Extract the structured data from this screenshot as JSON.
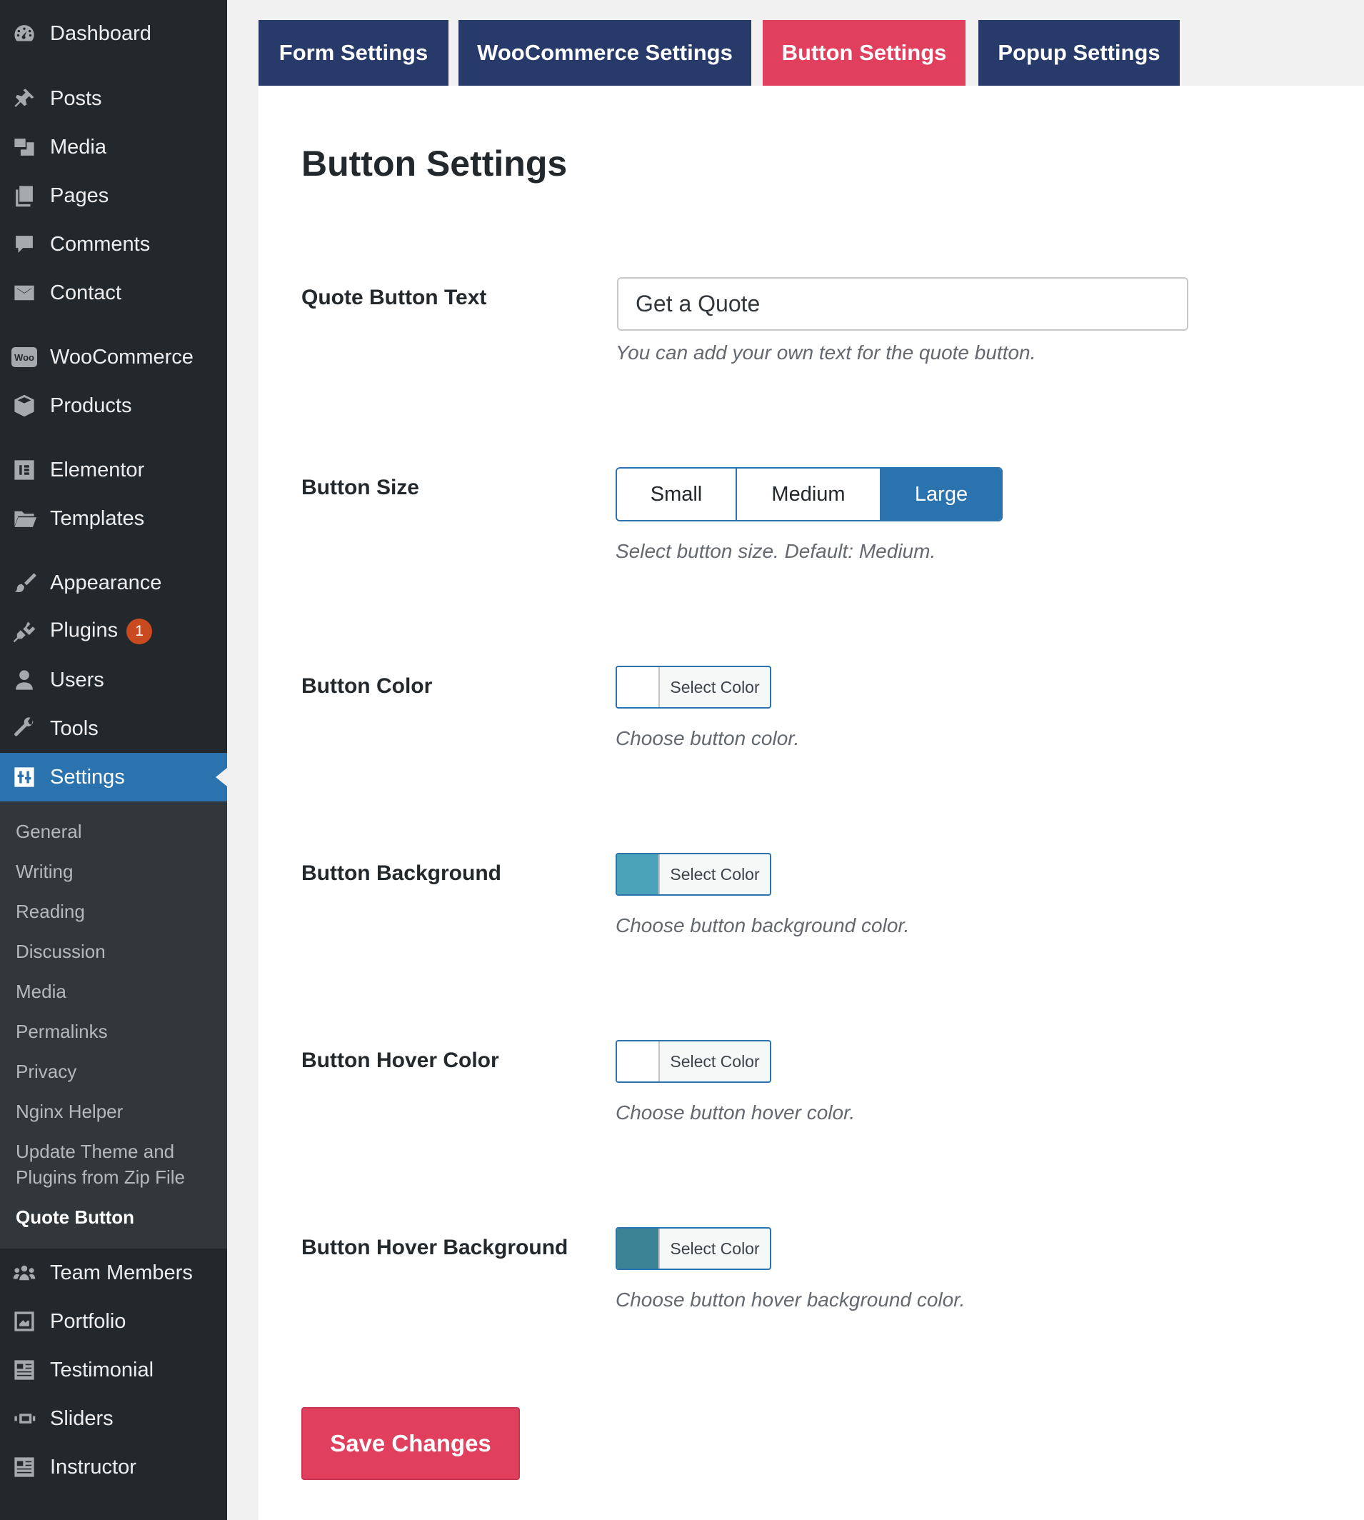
{
  "sidebar": {
    "items": [
      {
        "label": "Dashboard",
        "icon": "dashboard-icon"
      },
      {
        "label": "Posts",
        "icon": "pin-icon"
      },
      {
        "label": "Media",
        "icon": "media-icon"
      },
      {
        "label": "Pages",
        "icon": "pages-icon"
      },
      {
        "label": "Comments",
        "icon": "comment-icon"
      },
      {
        "label": "Contact",
        "icon": "envelope-icon"
      },
      {
        "label": "WooCommerce",
        "icon": "woo-icon",
        "icon_text": "Woo"
      },
      {
        "label": "Products",
        "icon": "box-icon"
      },
      {
        "label": "Elementor",
        "icon": "elementor-icon"
      },
      {
        "label": "Templates",
        "icon": "folder-icon"
      },
      {
        "label": "Appearance",
        "icon": "brush-icon"
      },
      {
        "label": "Plugins",
        "icon": "plugin-icon",
        "badge": "1"
      },
      {
        "label": "Users",
        "icon": "user-icon"
      },
      {
        "label": "Tools",
        "icon": "wrench-icon"
      },
      {
        "label": "Settings",
        "icon": "settings-icon"
      },
      {
        "label": "Team Members",
        "icon": "team-icon"
      },
      {
        "label": "Portfolio",
        "icon": "portfolio-icon"
      },
      {
        "label": "Testimonial",
        "icon": "testimonial-icon"
      },
      {
        "label": "Sliders",
        "icon": "slider-icon"
      },
      {
        "label": "Instructor",
        "icon": "instructor-icon"
      }
    ],
    "settings_submenu": [
      "General",
      "Writing",
      "Reading",
      "Discussion",
      "Media",
      "Permalinks",
      "Privacy",
      "Nginx Helper",
      "Update Theme and",
      "Plugins from Zip File",
      "Quote Button"
    ]
  },
  "tabs": [
    "Form Settings",
    "WooCommerce Settings",
    "Button Settings",
    "Popup Settings"
  ],
  "active_tab": "Button Settings",
  "page_title": "Button Settings",
  "fields": {
    "quote_text": {
      "label": "Quote Button Text",
      "value": "Get a Quote",
      "description": "You can add your own text for the quote button."
    },
    "size": {
      "label": "Button Size",
      "options": [
        "Small",
        "Medium",
        "Large"
      ],
      "selected": "Large",
      "description": "Select button size. Default: Medium."
    },
    "color": {
      "label": "Button Color",
      "picker_label": "Select Color",
      "swatch": "#ffffff",
      "description": "Choose button color."
    },
    "background": {
      "label": "Button Background",
      "picker_label": "Select Color",
      "swatch": "#4aa3b8",
      "description": "Choose button background color."
    },
    "hover_color": {
      "label": "Button Hover Color",
      "picker_label": "Select Color",
      "swatch": "#ffffff",
      "description": "Choose button hover color."
    },
    "hover_background": {
      "label": "Button Hover Background",
      "picker_label": "Select Color",
      "swatch": "#3a8496",
      "description": "Choose button hover background color."
    }
  },
  "save_label": "Save Changes",
  "colors": {
    "sidebar_bg": "#23282d",
    "submenu_bg": "#32373c",
    "active_menu": "#2b73ae",
    "tab_bg": "#273a6a",
    "tab_active": "#e0405e",
    "save_button": "#e0405e",
    "badge": "#ca4a1f"
  }
}
